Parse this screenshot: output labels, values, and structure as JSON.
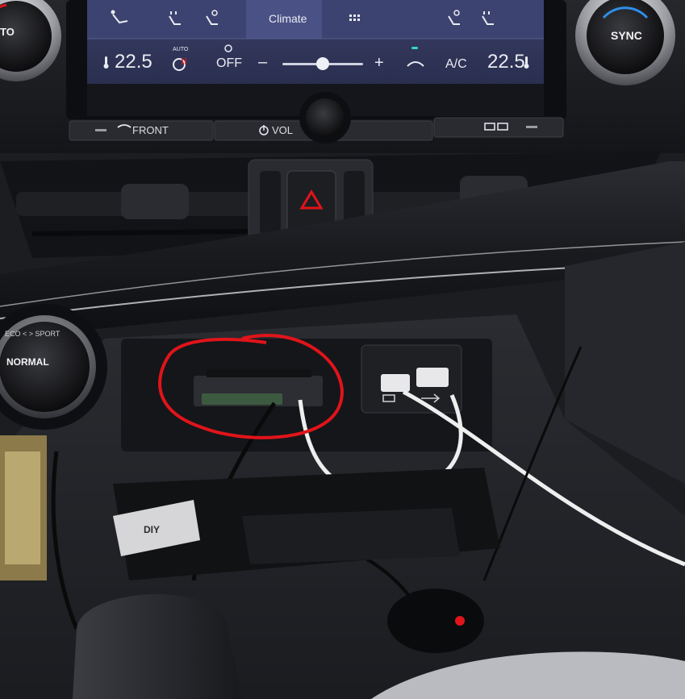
{
  "climate_screen": {
    "tab_label": "Climate",
    "left_temp": "22.5",
    "right_temp": "22.5",
    "fan_state": "OFF",
    "auto_label": "AUTO",
    "ac_label": "A/C",
    "minus": "–",
    "plus": "+"
  },
  "bezel": {
    "front_label": "FRONT",
    "vol_label": "VOL"
  },
  "knobs": {
    "left_fragment": "TO",
    "sync_label": "SYNC",
    "drive_mode_label": "NORMAL",
    "drive_mode_ring": "ECO < > SPORT"
  },
  "storage": {
    "sticker_text": "DIY"
  },
  "colors": {
    "annotation_circle": "#e0141a",
    "screen_bg": "#2e3357",
    "cable_white": "#eeeeee"
  }
}
